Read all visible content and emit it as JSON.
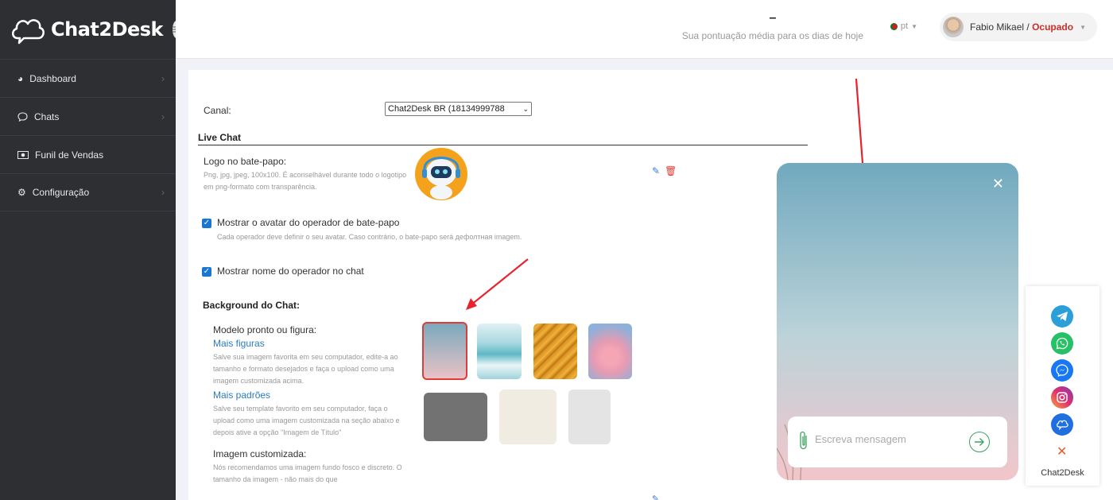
{
  "app": {
    "brand": "Chat2Desk"
  },
  "sidebar": {
    "items": [
      {
        "label": "Dashboard",
        "icon": "dashboard-icon"
      },
      {
        "label": "Chats",
        "icon": "chat-bubble-icon"
      },
      {
        "label": "Funil de Vendas",
        "icon": "money-icon"
      },
      {
        "label": "Configuração",
        "icon": "gear-icon"
      }
    ]
  },
  "header": {
    "score_value": "–",
    "score_label": "Sua pontuação média para os dias de hoje",
    "language": "pt",
    "user_name": "Fabio Mikael",
    "separator": "/",
    "user_status": "Ocupado"
  },
  "form": {
    "canal_label": "Canal:",
    "canal_value": "Chat2Desk BR (18134999788",
    "section_title": "Live Chat",
    "logo_title": "Logo no bate-papo:",
    "logo_help": "Png, jpg, jpeg, 100x100. É aconselhável durante todo o logotipo em png-formato com transparência.",
    "avatar_label": "Mostrar o avatar do operador de bate-papo",
    "avatar_help": "Cada operador deve definir o seu avatar. Caso contrário, o bate-papo será дефолтная imagem.",
    "name_label": "Mostrar nome do operador no chat",
    "bg_title": "Background do Chat:",
    "bg_model_title": "Modelo pronto ou figura:",
    "bg_more_figures": "Mais figuras",
    "bg_figures_help": "Salve sua imagem favorita em seu computador, edite-a ao tamanho e formato desejados e faça o upload como uma imagem customizada acima.",
    "bg_more_patterns": "Mais padrões",
    "bg_patterns_help": "Salve seu template favorito em seu computador, faça o upload como uma imagem customizada na seção abaixo e depois ative a opção \"Imagem de Título\"",
    "custom_title": "Imagem customizada:",
    "custom_help": "Nós recomendamos uma imagem fundo fosco e discreto. O tamanho da imagem - não mais do que"
  },
  "chat_widget": {
    "placeholder": "Escreva mensagem",
    "close_symbol": "✕"
  },
  "messenger_panel": {
    "channels": [
      "telegram-icon",
      "whatsapp-icon",
      "messenger-icon",
      "instagram-icon",
      "chat2desk-icon"
    ],
    "close_symbol": "✕",
    "label": "Chat2Desk"
  },
  "colors": {
    "sidebar_bg": "#2d2f33",
    "accent_blue": "#1976d2",
    "status_red": "#c9302c",
    "selected_border": "#e53935",
    "send_green": "#3aa35e"
  }
}
